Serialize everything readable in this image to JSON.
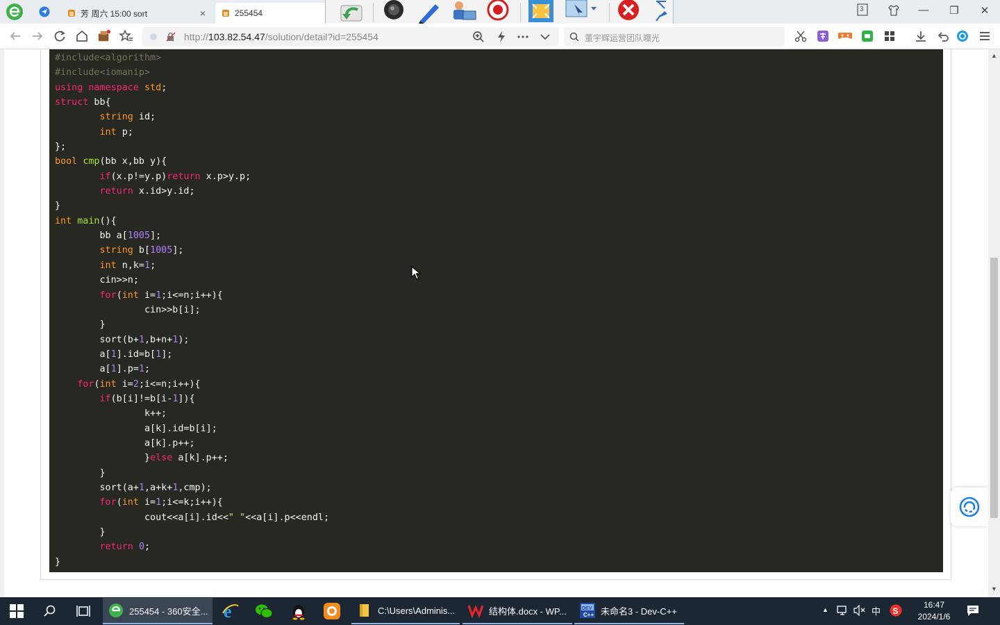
{
  "browser": {
    "tabs": [
      {
        "label": "芳 周六 15:00 sort",
        "close": "×"
      },
      {
        "label": "255454"
      }
    ],
    "tab_counter": "3",
    "window_controls": {
      "minimize": "—",
      "restore": "❐",
      "close": "✕"
    },
    "url_scheme": "http://",
    "url_host": "103.82.54.47",
    "url_path": "/solution/detail?id=255454",
    "search_placeholder": "董宇辉运营团队曝光"
  },
  "code_lines": [
    [
      [
        "pre",
        "#include<algorithm>"
      ]
    ],
    [
      [
        "pre",
        "#include<iomanip>"
      ]
    ],
    [
      [
        "kw",
        "using"
      ],
      [
        "pl",
        " "
      ],
      [
        "kw",
        "namespace"
      ],
      [
        "pl",
        " "
      ],
      [
        "ty",
        "std"
      ],
      [
        "pl",
        ";"
      ]
    ],
    [
      [
        "kw",
        "struct"
      ],
      [
        "pl",
        " bb{"
      ]
    ],
    [
      [
        "pl",
        "        "
      ],
      [
        "ty",
        "string"
      ],
      [
        "pl",
        " id;"
      ]
    ],
    [
      [
        "pl",
        "        "
      ],
      [
        "ty",
        "int"
      ],
      [
        "pl",
        " p;"
      ]
    ],
    [
      [
        "pl",
        "};"
      ]
    ],
    [
      [
        "ty",
        "bool"
      ],
      [
        "pl",
        " "
      ],
      [
        "fn",
        "cmp"
      ],
      [
        "pl",
        "(bb x,bb y){"
      ]
    ],
    [
      [
        "pl",
        "        "
      ],
      [
        "kw",
        "if"
      ],
      [
        "pl",
        "(x.p!=y.p)"
      ],
      [
        "kw",
        "return"
      ],
      [
        "pl",
        " x.p>y.p;"
      ]
    ],
    [
      [
        "pl",
        "        "
      ],
      [
        "kw",
        "return"
      ],
      [
        "pl",
        " x.id>y.id;"
      ]
    ],
    [
      [
        "pl",
        "}"
      ]
    ],
    [
      [
        "ty",
        "int"
      ],
      [
        "pl",
        " "
      ],
      [
        "fn",
        "main"
      ],
      [
        "pl",
        "(){"
      ]
    ],
    [
      [
        "pl",
        "        bb a["
      ],
      [
        "num",
        "1005"
      ],
      [
        "pl",
        "];"
      ]
    ],
    [
      [
        "pl",
        "        "
      ],
      [
        "ty",
        "string"
      ],
      [
        "pl",
        " b["
      ],
      [
        "num",
        "1005"
      ],
      [
        "pl",
        "];"
      ]
    ],
    [
      [
        "pl",
        "        "
      ],
      [
        "ty",
        "int"
      ],
      [
        "pl",
        " n,k="
      ],
      [
        "num",
        "1"
      ],
      [
        "pl",
        ";"
      ]
    ],
    [
      [
        "pl",
        "        cin>>n;"
      ]
    ],
    [
      [
        "pl",
        "        "
      ],
      [
        "kw",
        "for"
      ],
      [
        "pl",
        "("
      ],
      [
        "ty",
        "int"
      ],
      [
        "pl",
        " i="
      ],
      [
        "num",
        "1"
      ],
      [
        "pl",
        ";i<=n;i++){"
      ]
    ],
    [
      [
        "pl",
        "                cin>>b[i];"
      ]
    ],
    [
      [
        "pl",
        "        }"
      ]
    ],
    [
      [
        "pl",
        "        sort(b+"
      ],
      [
        "num",
        "1"
      ],
      [
        "pl",
        ",b+n+"
      ],
      [
        "num",
        "1"
      ],
      [
        "pl",
        ");"
      ]
    ],
    [
      [
        "pl",
        "        a["
      ],
      [
        "num",
        "1"
      ],
      [
        "pl",
        "].id=b["
      ],
      [
        "num",
        "1"
      ],
      [
        "pl",
        "];"
      ]
    ],
    [
      [
        "pl",
        "        a["
      ],
      [
        "num",
        "1"
      ],
      [
        "pl",
        "].p="
      ],
      [
        "num",
        "1"
      ],
      [
        "pl",
        ";"
      ]
    ],
    [
      [
        "pl",
        "    "
      ],
      [
        "kw",
        "for"
      ],
      [
        "pl",
        "("
      ],
      [
        "ty",
        "int"
      ],
      [
        "pl",
        " i="
      ],
      [
        "num",
        "2"
      ],
      [
        "pl",
        ";i<=n;i++){"
      ]
    ],
    [
      [
        "pl",
        "        "
      ],
      [
        "kw",
        "if"
      ],
      [
        "pl",
        "(b[i]!=b[i-"
      ],
      [
        "num",
        "1"
      ],
      [
        "pl",
        "]){"
      ]
    ],
    [
      [
        "pl",
        "                k++;"
      ]
    ],
    [
      [
        "pl",
        "                a[k].id=b[i];"
      ]
    ],
    [
      [
        "pl",
        "                a[k].p++;"
      ]
    ],
    [
      [
        "pl",
        "                }"
      ],
      [
        "kw",
        "else"
      ],
      [
        "pl",
        " a[k].p++;"
      ]
    ],
    [
      [
        "pl",
        "        }"
      ]
    ],
    [
      [
        "pl",
        "        sort(a+"
      ],
      [
        "num",
        "1"
      ],
      [
        "pl",
        ",a+k+"
      ],
      [
        "num",
        "1"
      ],
      [
        "pl",
        ",cmp);"
      ]
    ],
    [
      [
        "pl",
        "        "
      ],
      [
        "kw",
        "for"
      ],
      [
        "pl",
        "("
      ],
      [
        "ty",
        "int"
      ],
      [
        "pl",
        " i="
      ],
      [
        "num",
        "1"
      ],
      [
        "pl",
        ";i<=k;i++){"
      ]
    ],
    [
      [
        "pl",
        "                cout<<a[i].id<<"
      ],
      [
        "str",
        "\" \""
      ],
      [
        "pl",
        "<<a[i].p<<endl;"
      ]
    ],
    [
      [
        "pl",
        "        }"
      ]
    ],
    [
      [
        "pl",
        "        "
      ],
      [
        "kw",
        "return"
      ],
      [
        "pl",
        " "
      ],
      [
        "num",
        "0"
      ],
      [
        "pl",
        ";"
      ]
    ],
    [
      [
        "pl",
        "}"
      ]
    ]
  ],
  "taskbar": {
    "apps": [
      {
        "label": "255454 - 360安全..."
      },
      {
        "label": "C:\\Users\\Adminis..."
      },
      {
        "label": "结构体.docx - WP..."
      },
      {
        "label": "未命名3 - Dev-C++"
      }
    ],
    "ime": "中",
    "time": "16:47",
    "date": "2024/1/6"
  },
  "colors": {
    "code_bg": "#272822",
    "keyword": "#f92672",
    "type": "#fd971f",
    "function": "#a6e22e",
    "number": "#ae81ff",
    "comment": "#75715e",
    "taskbar_bg": "#1d2633"
  }
}
